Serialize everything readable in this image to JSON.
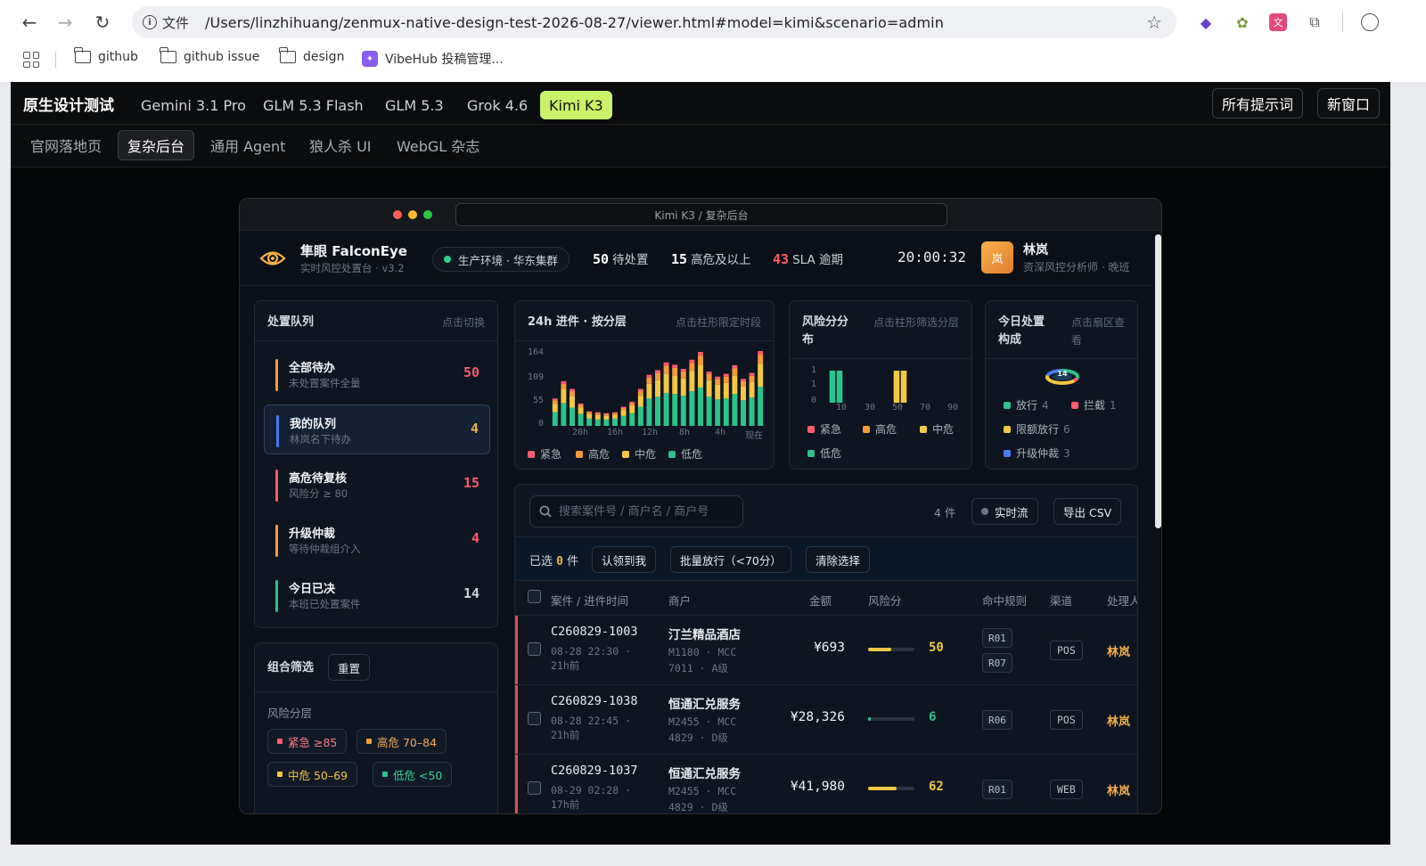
{
  "browser": {
    "file_label": "文件",
    "url": "/Users/linzhihuang/zenmux-native-design-test-2026-08-27/viewer.html#model=kimi&scenario=admin",
    "bookmarks": [
      "github",
      "github issue",
      "design",
      "VibeHub 投稿管理..."
    ]
  },
  "app": {
    "brand": "原生设计测试",
    "models": [
      "Gemini 3.1 Pro",
      "GLM 5.3 Flash",
      "GLM 5.3",
      "Grok 4.6",
      "Kimi K3"
    ],
    "active_model": "Kimi K3",
    "all_prompts": "所有提示词",
    "new_window": "新窗口",
    "scenarios": [
      "官网落地页",
      "复杂后台",
      "通用 Agent",
      "狼人杀 UI",
      "WebGL 杂志"
    ],
    "active_scenario": "复杂后台"
  },
  "preview": {
    "title": "Kimi K3 / 复杂后台"
  },
  "dash": {
    "logo_name": "隼眼 FalconEye",
    "logo_sub": "实时风控处置台 · v3.2",
    "env": "生产环境 · 华东集群",
    "stats": [
      {
        "value": "50",
        "label": "待处置"
      },
      {
        "value": "15",
        "label": "高危及以上"
      },
      {
        "value": "43",
        "label": "SLA 逾期"
      }
    ],
    "clock": "20:00:32",
    "avatar": "岚",
    "user_name": "林岚",
    "user_role": "资深风控分析师 · 晚班"
  },
  "queue": {
    "title": "处置队列",
    "hint": "点击切换",
    "items": [
      {
        "name": "全部待办",
        "sub": "未处置案件全量",
        "count": "50"
      },
      {
        "name": "我的队列",
        "sub": "林岚名下待办",
        "count": "4"
      },
      {
        "name": "高危待复核",
        "sub": "风险分 ≥ 80",
        "count": "15"
      },
      {
        "name": "升级仲裁",
        "sub": "等待仲裁组介入",
        "count": "4"
      },
      {
        "name": "今日已决",
        "sub": "本班已处置案件",
        "count": "14"
      }
    ]
  },
  "filter": {
    "title": "组合筛选",
    "reset": "重置",
    "group_label": "风险分层",
    "chips": [
      "紧急 ≥85",
      "高危 70–84",
      "中危 50–69",
      "低危 <50"
    ]
  },
  "colors": {
    "urgent": "#ff5a6e",
    "high": "#f59a3a",
    "mid": "#f2c744",
    "low": "#2bc48a",
    "blue": "#4a7cf0"
  },
  "chart1": {
    "title": "24h 进件 · 按分层",
    "hint": "点击柱形限定时段",
    "legend": [
      "紧急",
      "高危",
      "中危",
      "低危"
    ],
    "yticks": [
      "164",
      "109",
      "55",
      "0"
    ],
    "xticks": [
      "20h",
      "16h",
      "12h",
      "8h",
      "4h",
      "现在"
    ]
  },
  "chart2": {
    "title": "风险分分布",
    "hint": "点击柱形筛选分层",
    "yticks": [
      "1",
      "1",
      "0"
    ],
    "xticks": [
      "10",
      "30",
      "50",
      "70",
      "90"
    ],
    "legend": [
      "紧急",
      "高危",
      "中危",
      "低危"
    ]
  },
  "chart3": {
    "title": "今日处置构成",
    "hint": "点击扇区查看",
    "center": "14",
    "legend": [
      {
        "label": "放行",
        "n": "4"
      },
      {
        "label": "拦截",
        "n": "1"
      },
      {
        "label": "限额放行",
        "n": "6"
      },
      {
        "label": "升级仲裁",
        "n": "3"
      }
    ]
  },
  "chart_data": [
    {
      "type": "bar",
      "title": "24h 进件 · 按分层",
      "x": [
        "24h",
        "23h",
        "22h",
        "21h",
        "20h",
        "19h",
        "18h",
        "17h",
        "16h",
        "15h",
        "14h",
        "13h",
        "12h",
        "11h",
        "10h",
        "9h",
        "8h",
        "7h",
        "6h",
        "5h",
        "4h",
        "3h",
        "2h",
        "1h",
        "现在"
      ],
      "series": [
        {
          "name": "紧急",
          "values": [
            4,
            6,
            5,
            3,
            2,
            2,
            2,
            2,
            3,
            3,
            5,
            6,
            6,
            7,
            7,
            6,
            7,
            8,
            5,
            5,
            6,
            7,
            5,
            6,
            8
          ]
        },
        {
          "name": "高危",
          "values": [
            8,
            12,
            10,
            6,
            4,
            4,
            4,
            4,
            5,
            6,
            10,
            14,
            16,
            18,
            17,
            15,
            18,
            20,
            14,
            13,
            14,
            16,
            12,
            14,
            20
          ]
        },
        {
          "name": "中危",
          "values": [
            18,
            30,
            26,
            14,
            10,
            10,
            8,
            8,
            12,
            16,
            24,
            32,
            36,
            42,
            40,
            38,
            44,
            50,
            36,
            32,
            34,
            40,
            30,
            34,
            50
          ]
        },
        {
          "name": "低危",
          "values": [
            30,
            50,
            40,
            26,
            16,
            14,
            14,
            16,
            22,
            28,
            42,
            60,
            64,
            72,
            70,
            66,
            76,
            84,
            64,
            58,
            60,
            70,
            56,
            62,
            86
          ]
        }
      ],
      "ylim": [
        0,
        164
      ]
    },
    {
      "type": "bar",
      "title": "风险分分布",
      "categories": [
        "0-5",
        "5-10",
        "10-15",
        "15-20",
        "20-25",
        "25-30",
        "30-35",
        "35-40",
        "40-45",
        "45-50",
        "50-55",
        "55-60",
        "60-65",
        "65-70",
        "70-75",
        "75-80",
        "80-85",
        "85-90",
        "90-95",
        "95-100"
      ],
      "values": [
        0,
        1,
        1,
        0,
        0,
        0,
        0,
        0,
        0,
        0,
        1,
        1,
        0,
        0,
        0,
        0,
        0,
        0,
        0,
        0
      ],
      "ylim": [
        0,
        1
      ]
    },
    {
      "type": "pie",
      "title": "今日处置构成",
      "categories": [
        "放行",
        "拦截",
        "限额放行",
        "升级仲裁"
      ],
      "values": [
        4,
        1,
        6,
        3
      ]
    }
  ],
  "table": {
    "search_placeholder": "搜索案件号 / 商户名 / 商户号",
    "count": "4 件",
    "realtime": "实时流",
    "export": "导出 CSV",
    "selected_prefix": "已选",
    "selected_count": "0",
    "selected_suffix": "件",
    "actions": [
      "认领到我",
      "批量放行（<70分）",
      "清除选择"
    ],
    "headers": [
      "案件 / 进件时间",
      "商户",
      "金额",
      "风险分",
      "命中规则",
      "渠道",
      "处理人"
    ],
    "rows": [
      {
        "id": "C260829-1003",
        "time": "08-28 22:30 ·",
        "ago": "21h前",
        "merchant": "汀兰精品酒店",
        "meta1": "M1180 · MCC",
        "meta2": "7011 · A级",
        "amount": "¥693",
        "score": 50,
        "rules": [
          "R01",
          "R07"
        ],
        "channel": "POS",
        "handler": "林岚"
      },
      {
        "id": "C260829-1038",
        "time": "08-28 22:45 ·",
        "ago": "21h前",
        "merchant": "恒通汇兑服务",
        "meta1": "M2455 · MCC",
        "meta2": "4829 · D级",
        "amount": "¥28,326",
        "score": 6,
        "rules": [
          "R06"
        ],
        "channel": "POS",
        "handler": "林岚"
      },
      {
        "id": "C260829-1037",
        "time": "08-29 02:28 ·",
        "ago": "17h前",
        "merchant": "恒通汇兑服务",
        "meta1": "M2455 · MCC",
        "meta2": "4829 · D级",
        "amount": "¥41,980",
        "score": 62,
        "rules": [
          "R01"
        ],
        "channel": "WEB",
        "handler": "林岚"
      }
    ]
  }
}
